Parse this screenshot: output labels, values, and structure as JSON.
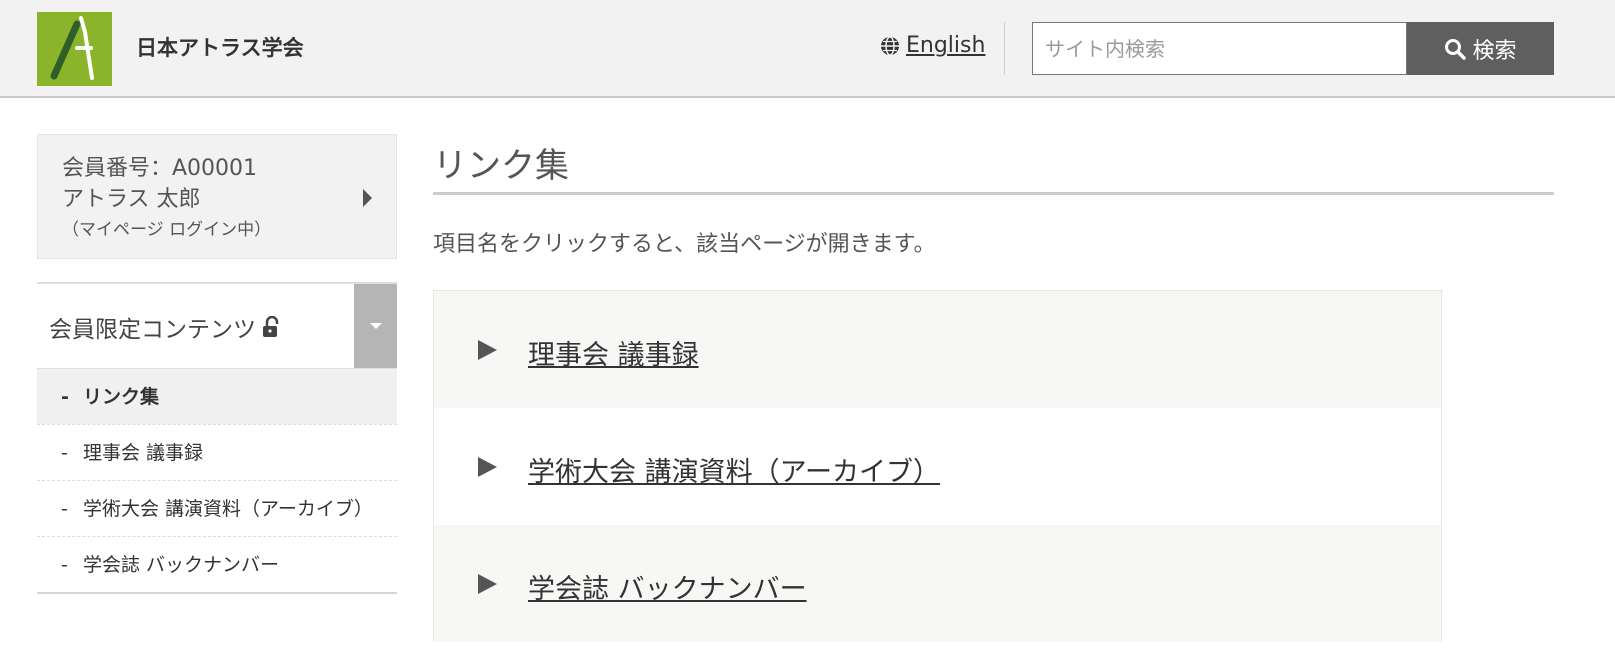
{
  "header": {
    "site_title": "日本アトラス学会",
    "lang_link": "English",
    "search_placeholder": "サイト内検索",
    "search_button": "検索"
  },
  "sidebar": {
    "member": {
      "number_line": "会員番号：A00001",
      "name": "アトラス 太郎",
      "status": "（マイページ ログイン中）"
    },
    "menu_title": "会員限定コンテンツ",
    "items": [
      {
        "label": "リンク集",
        "active": true
      },
      {
        "label": "理事会 議事録",
        "active": false
      },
      {
        "label": "学術大会 講演資料（アーカイブ）",
        "active": false
      },
      {
        "label": "学会誌 バックナンバー",
        "active": false
      }
    ],
    "dash": "-"
  },
  "main": {
    "title": "リンク集",
    "intro": "項目名をクリックすると、該当ページが開きます。",
    "links": [
      {
        "label": "理事会 議事録"
      },
      {
        "label": "学術大会 講演資料（アーカイブ）"
      },
      {
        "label": "学会誌 バックナンバー"
      }
    ]
  },
  "colors": {
    "logo_green": "#8ab52a",
    "search_button_bg": "#5f5f5f",
    "header_bg": "#f2f2f2"
  },
  "icons": {
    "logo": "letter-a-logo",
    "lang": "globe-icon",
    "search": "magnifier-icon",
    "member_arrow": "caret-right-icon",
    "lock": "unlocked-padlock-icon",
    "toggle": "caret-down-icon",
    "link_bullet": "triangle-right-icon"
  }
}
